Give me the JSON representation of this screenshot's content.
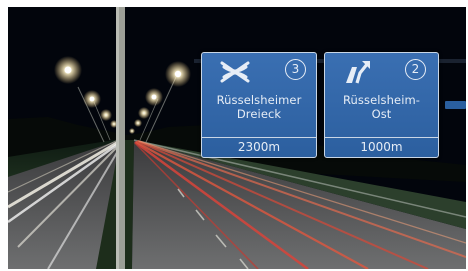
{
  "signs": [
    {
      "exit_number": "3",
      "symbol": "interchange-icon",
      "destination_line1": "Rüsselsheimer",
      "destination_line2": "Dreieck",
      "distance": "2300m"
    },
    {
      "exit_number": "2",
      "symbol": "exit-arrow-icon",
      "destination_line1": "Rüsselsheim-",
      "destination_line2": "Ost",
      "distance": "1000m"
    }
  ],
  "colors": {
    "sign_blue": "#2f63a5",
    "sky": "#02050c",
    "light_trail_red": "#d9443a",
    "light_trail_white": "#f4f1e6",
    "street_lamp": "#fff6d6"
  }
}
